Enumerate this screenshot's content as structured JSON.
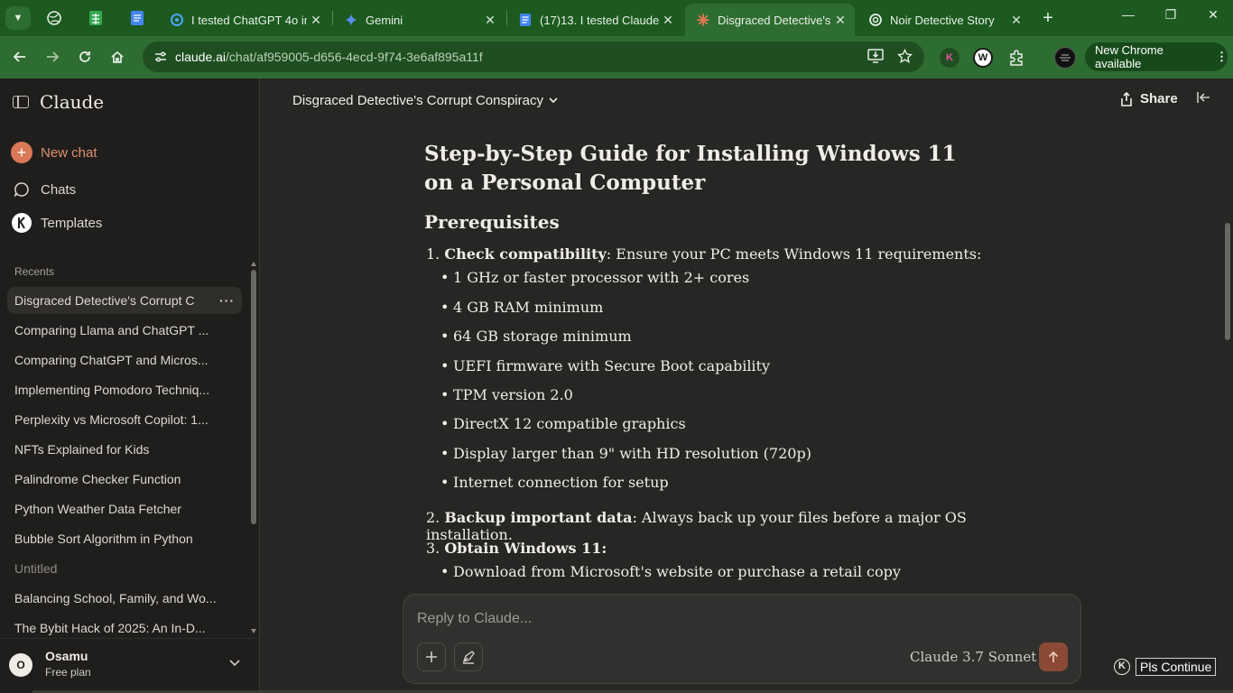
{
  "browser": {
    "tabs": [
      {
        "title": "I tested ChatGPT 4o im",
        "close": "✕"
      },
      {
        "title": "Gemini",
        "close": "✕"
      },
      {
        "title": "(17)13. I tested Claude",
        "close": "✕"
      },
      {
        "title": "Disgraced Detective's C",
        "close": "✕",
        "active": true
      },
      {
        "title": "Noir Detective Story",
        "close": "✕"
      }
    ],
    "new_tab": "+",
    "window_controls": {
      "minimize": "—",
      "restore": "❐",
      "close": "✕"
    },
    "url_host": "claude.ai",
    "url_path": "/chat/af959005-d656-4ecd-9f74-3e6af895a11f",
    "new_chrome_label": "New Chrome available",
    "new_chrome_menu": "⋮",
    "ext_k_label": "K",
    "ext_w_label": "W"
  },
  "sidebar": {
    "logo": "Claude",
    "new_chat": "New chat",
    "nav": [
      {
        "label": "Chats"
      },
      {
        "label": "Templates"
      }
    ],
    "recents_heading": "Recents",
    "recents": [
      {
        "label": "Disgraced Detective's Corrupt C"
      },
      {
        "label": "Comparing Llama and ChatGPT ..."
      },
      {
        "label": "Comparing ChatGPT and Micros..."
      },
      {
        "label": "Implementing Pomodoro Techniq..."
      },
      {
        "label": "Perplexity vs Microsoft Copilot: 1..."
      },
      {
        "label": "NFTs Explained for Kids"
      },
      {
        "label": "Palindrome Checker Function"
      },
      {
        "label": "Python Weather Data Fetcher"
      },
      {
        "label": "Bubble Sort Algorithm in Python"
      },
      {
        "label": "Untitled"
      },
      {
        "label": "Balancing School, Family, and Wo..."
      },
      {
        "label": "The Bybit Hack of 2025: An In-D..."
      }
    ],
    "more_label": "···",
    "user": {
      "initial": "O",
      "name": "Osamu",
      "plan": "Free plan"
    }
  },
  "header": {
    "chat_title": "Disgraced Detective's Corrupt Conspiracy",
    "share_label": "Share"
  },
  "message": {
    "title": "Step-by-Step Guide for Installing Windows 11 on a Personal Computer",
    "prereq_heading": "Prerequisites",
    "item1_num": "1.",
    "item1_bold": "Check compatibility",
    "item1_text": ": Ensure your PC meets Windows 11 requirements:",
    "item1_bullets": [
      "1 GHz or faster processor with 2+ cores",
      "4 GB RAM minimum",
      "64 GB storage minimum",
      "UEFI firmware with Secure Boot capability",
      "TPM version 2.0",
      "DirectX 12 compatible graphics",
      "Display larger than 9\" with HD resolution (720p)",
      "Internet connection for setup"
    ],
    "item2_num": "2.",
    "item2_bold": "Backup important data",
    "item2_text": ": Always back up your files before a major OS installation.",
    "item3_num": "3.",
    "item3_bold": "Obtain Windows 11:",
    "item3_bullets": [
      "Download from Microsoft's website or purchase a retail copy"
    ]
  },
  "composer": {
    "placeholder": "Reply to Claude...",
    "model": "Claude 3.7 Sonnet"
  },
  "floating": {
    "icon_letter": "K",
    "label": "Pls Continue"
  },
  "colors": {
    "chrome_green": "#2e6d31",
    "accent": "#d97757",
    "bg": "#262624"
  }
}
